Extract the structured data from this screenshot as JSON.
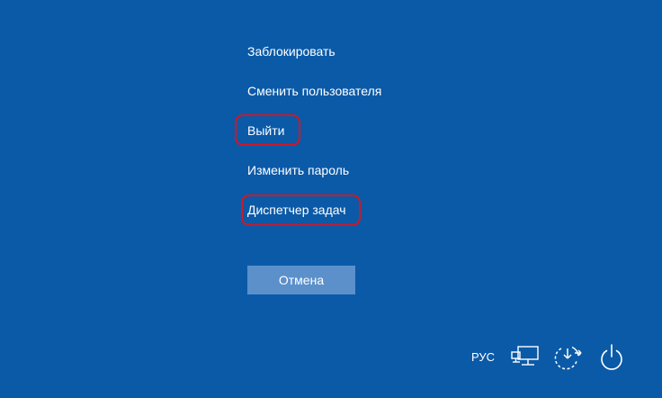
{
  "menu": {
    "lock": "Заблокировать",
    "switch_user": "Сменить пользователя",
    "sign_out": "Выйти",
    "change_password": "Изменить пароль",
    "task_manager": "Диспетчер задач"
  },
  "cancel_label": "Отмена",
  "tray": {
    "language": "РУС",
    "icons": [
      "network-icon",
      "ease-of-access-icon",
      "power-icon"
    ]
  },
  "colors": {
    "background": "#0b5aa8",
    "button": "#5b90cb",
    "highlight": "#d9141f",
    "text": "#ffffff"
  }
}
